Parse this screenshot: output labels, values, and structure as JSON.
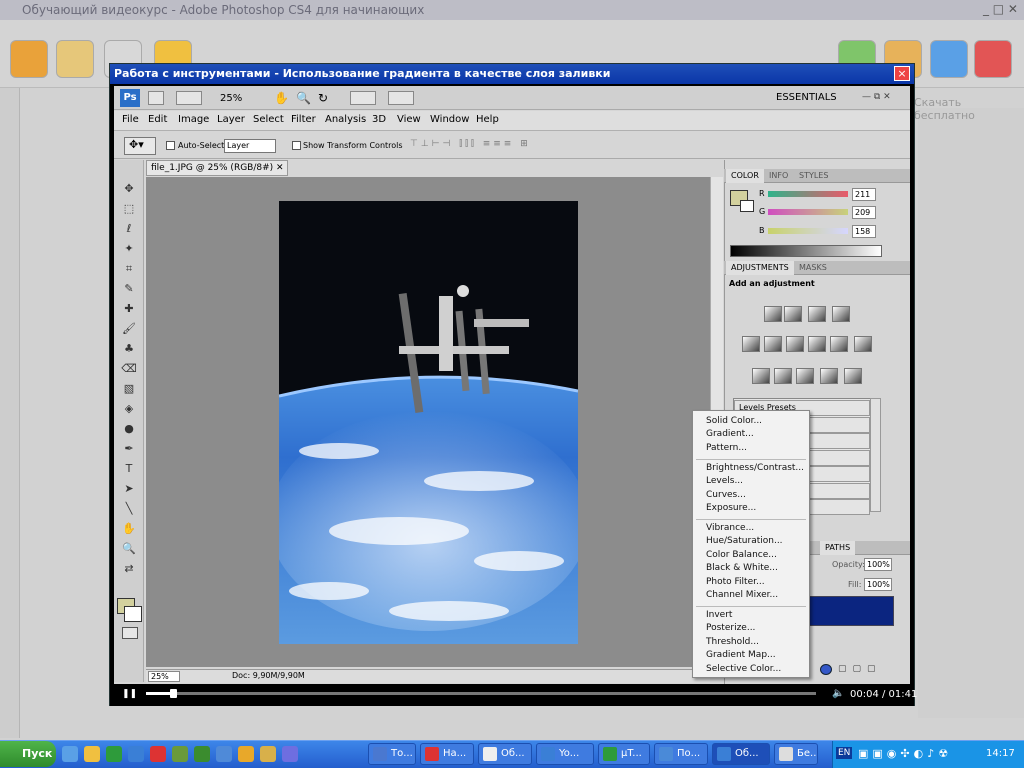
{
  "outer": {
    "title": "Обучающий видеокурс - Adobe Photoshop CS4 для начинающих",
    "right_text": "Скачать бесплатно"
  },
  "video": {
    "title": "Работа с инструментами - Использование градиента в качестве слоя заливки",
    "close": "×",
    "time": "00:04 / 01:41",
    "progress": 0.04
  },
  "ps": {
    "logo": "Ps",
    "zoom": "25%",
    "workspace": "ESSENTIALS",
    "menu": [
      "File",
      "Edit",
      "Image",
      "Layer",
      "Select",
      "Filter",
      "Analysis",
      "3D",
      "View",
      "Window",
      "Help"
    ],
    "options": {
      "auto_select": "Auto-Select:",
      "layer": "Layer",
      "transform": "Show Transform Controls"
    },
    "doc_tab": "file_1.JPG @ 25% (RGB/8#)",
    "status_zoom": "25%",
    "status_doc": "Doc: 9,90M/9,90M",
    "color_tabs": [
      "COLOR",
      "INFO",
      "STYLES"
    ],
    "rgb": [
      {
        "label": "R",
        "value": "211"
      },
      {
        "label": "G",
        "value": "209"
      },
      {
        "label": "B",
        "value": "158"
      }
    ],
    "adj_tabs": [
      "ADJUSTMENTS",
      "MASKS"
    ],
    "adj_title": "Add an adjustment",
    "presets": [
      "Levels Presets",
      "",
      "",
      "resets",
      "resets",
      "resets",
      "resets"
    ],
    "layer_tabs": [
      "PATHS"
    ],
    "opacity_label": "Opacity:",
    "opacity": "100%",
    "fill_label": "Fill:",
    "fill": "100%",
    "fg_color": "#d3d19e"
  },
  "context_menu": {
    "groups": [
      [
        "Solid Color...",
        "Gradient...",
        "Pattern..."
      ],
      [
        "Brightness/Contrast...",
        "Levels...",
        "Curves...",
        "Exposure..."
      ],
      [
        "Vibrance...",
        "Hue/Saturation...",
        "Color Balance...",
        "Black & White...",
        "Photo Filter...",
        "Channel Mixer..."
      ],
      [
        "Invert",
        "Posterize...",
        "Threshold...",
        "Gradient Map...",
        "Selective Color..."
      ]
    ]
  },
  "taskbar": {
    "start": "Пуск",
    "tasks": [
      "То...",
      "На...",
      "Об...",
      "Yo...",
      "µT...",
      "По...",
      "Об...",
      "Бе..."
    ],
    "lang": "EN",
    "clock": "14:17"
  }
}
